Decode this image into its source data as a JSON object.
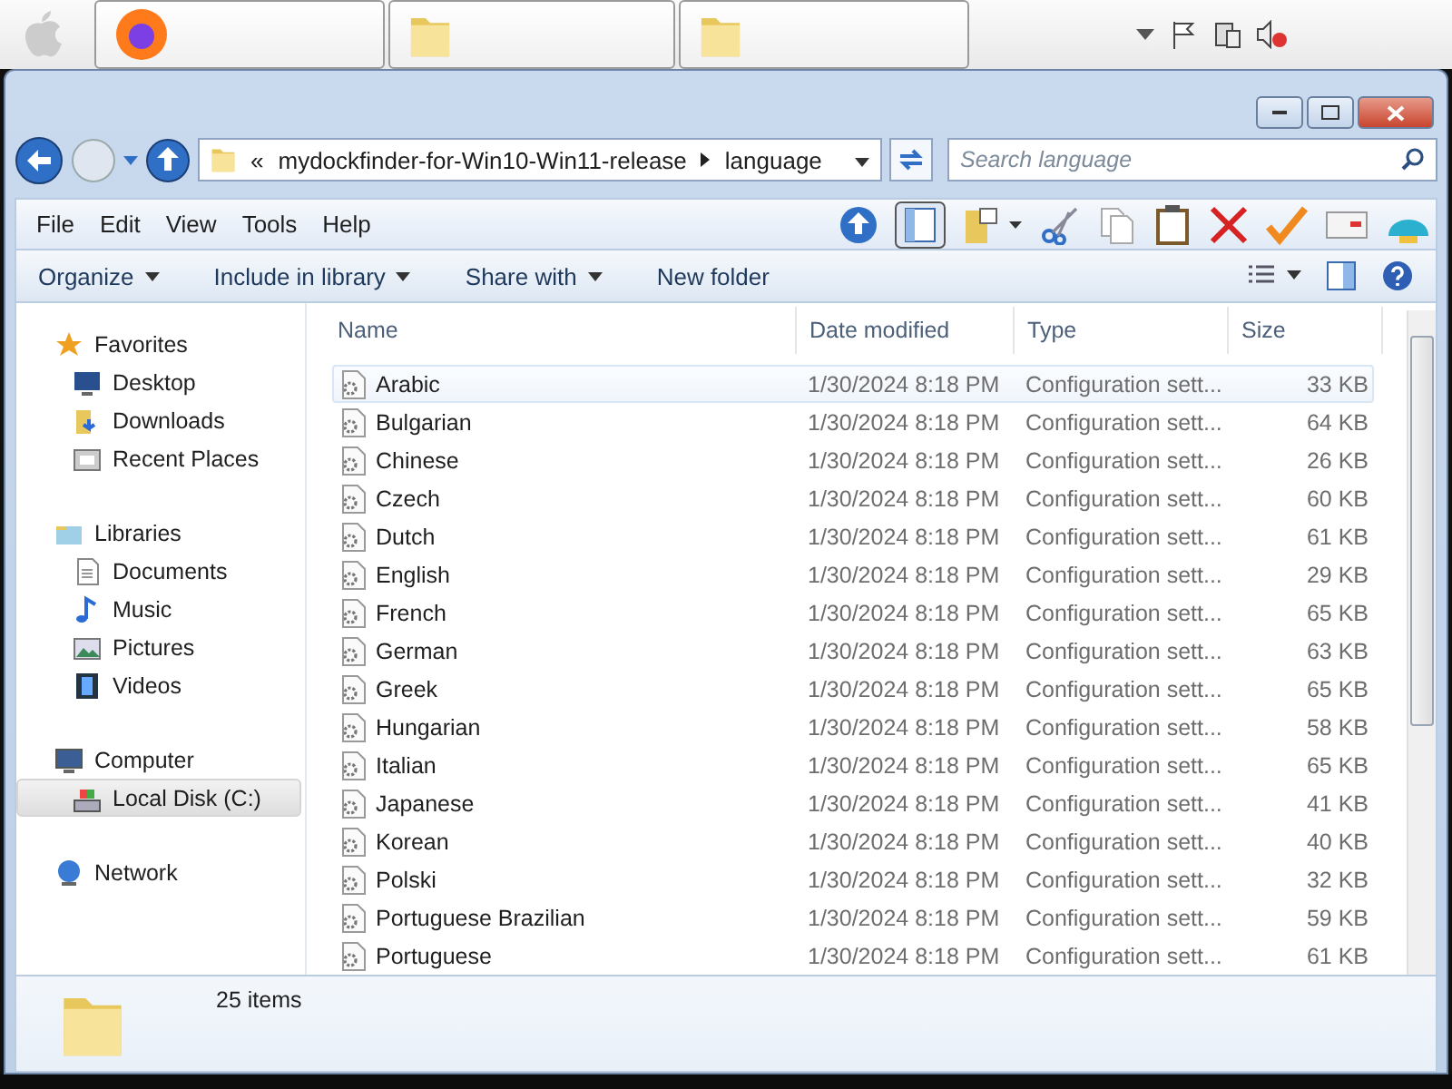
{
  "taskbar": {
    "windows": [
      {
        "kind": "browser"
      },
      {
        "kind": "folder"
      },
      {
        "kind": "folder"
      }
    ]
  },
  "address": {
    "overflow": "«",
    "segments": [
      "mydockfinder-for-Win10-Win11-release",
      "language"
    ]
  },
  "search": {
    "placeholder": "Search language"
  },
  "menu": [
    "File",
    "Edit",
    "View",
    "Tools",
    "Help"
  ],
  "commands": [
    {
      "label": "Organize",
      "dropdown": true
    },
    {
      "label": "Include in library",
      "dropdown": true
    },
    {
      "label": "Share with",
      "dropdown": true
    },
    {
      "label": "New folder",
      "dropdown": false
    }
  ],
  "sidebar": [
    {
      "label": "Favorites",
      "children": [
        {
          "label": "Desktop",
          "selected": false
        },
        {
          "label": "Downloads",
          "selected": false
        },
        {
          "label": "Recent Places",
          "selected": false
        }
      ]
    },
    {
      "label": "Libraries",
      "children": [
        {
          "label": "Documents",
          "selected": false
        },
        {
          "label": "Music",
          "selected": false
        },
        {
          "label": "Pictures",
          "selected": false
        },
        {
          "label": "Videos",
          "selected": false
        }
      ]
    },
    {
      "label": "Computer",
      "children": [
        {
          "label": "Local Disk (C:)",
          "selected": true
        }
      ]
    },
    {
      "label": "Network"
    }
  ],
  "columns": [
    "Name",
    "Date modified",
    "Type",
    "Size"
  ],
  "rows": [
    {
      "name": "Arabic",
      "date": "1/30/2024 8:18 PM",
      "type": "Configuration sett...",
      "size": "33 KB",
      "selected": true
    },
    {
      "name": "Bulgarian",
      "date": "1/30/2024 8:18 PM",
      "type": "Configuration sett...",
      "size": "64 KB",
      "selected": false
    },
    {
      "name": "Chinese",
      "date": "1/30/2024 8:18 PM",
      "type": "Configuration sett...",
      "size": "26 KB",
      "selected": false
    },
    {
      "name": "Czech",
      "date": "1/30/2024 8:18 PM",
      "type": "Configuration sett...",
      "size": "60 KB",
      "selected": false
    },
    {
      "name": "Dutch",
      "date": "1/30/2024 8:18 PM",
      "type": "Configuration sett...",
      "size": "61 KB",
      "selected": false
    },
    {
      "name": "English",
      "date": "1/30/2024 8:18 PM",
      "type": "Configuration sett...",
      "size": "29 KB",
      "selected": false
    },
    {
      "name": "French",
      "date": "1/30/2024 8:18 PM",
      "type": "Configuration sett...",
      "size": "65 KB",
      "selected": false
    },
    {
      "name": "German",
      "date": "1/30/2024 8:18 PM",
      "type": "Configuration sett...",
      "size": "63 KB",
      "selected": false
    },
    {
      "name": "Greek",
      "date": "1/30/2024 8:18 PM",
      "type": "Configuration sett...",
      "size": "65 KB",
      "selected": false
    },
    {
      "name": "Hungarian",
      "date": "1/30/2024 8:18 PM",
      "type": "Configuration sett...",
      "size": "58 KB",
      "selected": false
    },
    {
      "name": "Italian",
      "date": "1/30/2024 8:18 PM",
      "type": "Configuration sett...",
      "size": "65 KB",
      "selected": false
    },
    {
      "name": "Japanese",
      "date": "1/30/2024 8:18 PM",
      "type": "Configuration sett...",
      "size": "41 KB",
      "selected": false
    },
    {
      "name": "Korean",
      "date": "1/30/2024 8:18 PM",
      "type": "Configuration sett...",
      "size": "40 KB",
      "selected": false
    },
    {
      "name": "Polski",
      "date": "1/30/2024 8:18 PM",
      "type": "Configuration sett...",
      "size": "32 KB",
      "selected": false
    },
    {
      "name": "Portuguese Brazilian",
      "date": "1/30/2024 8:18 PM",
      "type": "Configuration sett...",
      "size": "59 KB",
      "selected": false
    },
    {
      "name": "Portuguese",
      "date": "1/30/2024 8:18 PM",
      "type": "Configuration sett...",
      "size": "61 KB",
      "selected": false
    }
  ],
  "status": {
    "count": "25 items"
  }
}
